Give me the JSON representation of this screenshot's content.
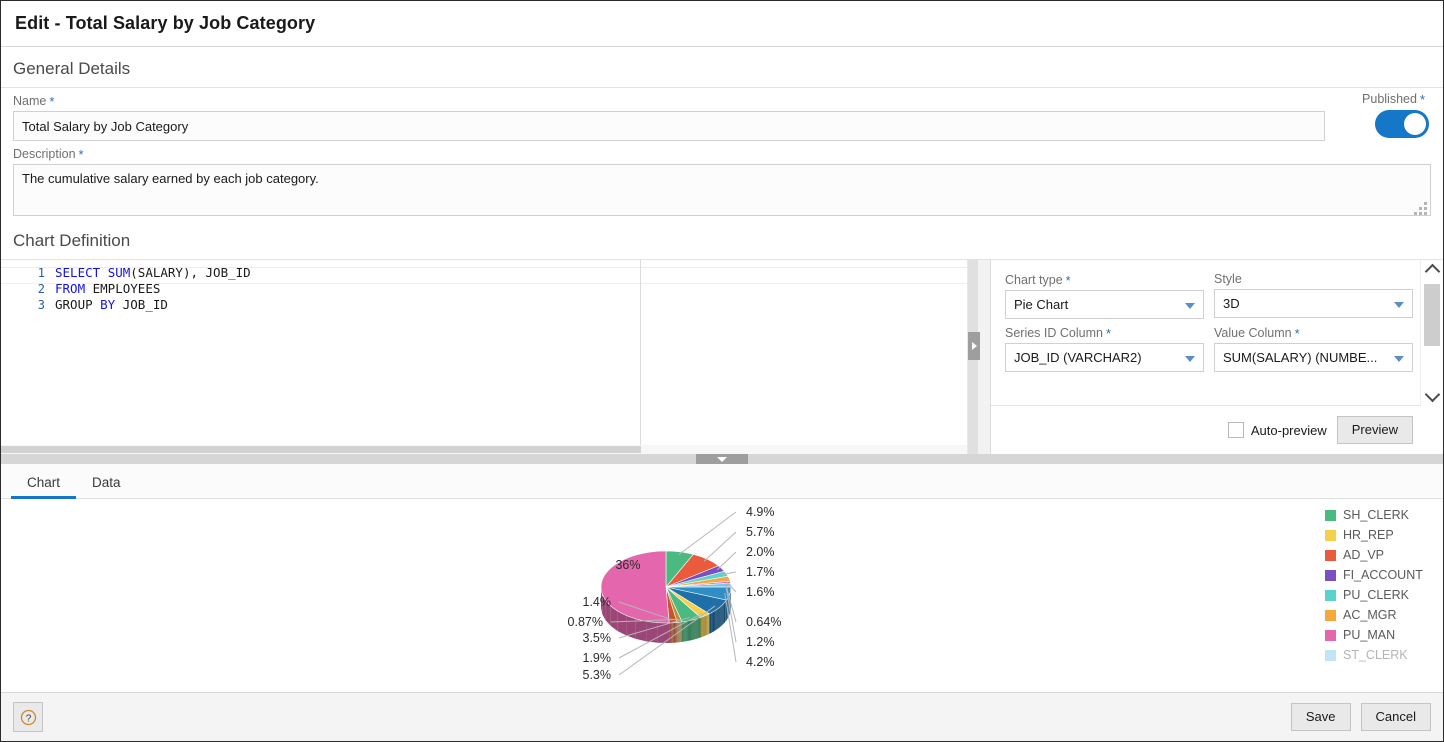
{
  "window": {
    "title": "Edit - Total Salary by Job Category"
  },
  "general": {
    "section_title": "General Details",
    "name_label": "Name",
    "name_value": "Total Salary by Job Category",
    "name_placeholder": "",
    "description_label": "Description",
    "description_value": "The cumulative salary earned by each job category.",
    "description_placeholder": "",
    "published_label": "Published",
    "published_state": "on",
    "required_marker": "*"
  },
  "chart_definition": {
    "section_title": "Chart Definition",
    "code_lines": [
      {
        "number": "1",
        "tokens": [
          {
            "t": "SELECT",
            "kw": true
          },
          {
            "t": " ",
            "kw": false
          },
          {
            "t": "SUM",
            "kw": true
          },
          {
            "t": "(SALARY), JOB_ID",
            "kw": false
          }
        ]
      },
      {
        "number": "2",
        "tokens": [
          {
            "t": "FROM",
            "kw": true
          },
          {
            "t": " EMPLOYEES",
            "kw": false
          }
        ]
      },
      {
        "number": "3",
        "tokens": [
          {
            "t": "GROUP ",
            "kw": false
          },
          {
            "t": "BY",
            "kw": true
          },
          {
            "t": " JOB_ID",
            "kw": false
          }
        ]
      }
    ]
  },
  "config": {
    "chart_type_label": "Chart type",
    "chart_type_value": "Pie Chart",
    "style_label": "Style",
    "style_value": "3D",
    "series_id_label": "Series ID Column",
    "series_id_value": "JOB_ID (VARCHAR2)",
    "value_column_label": "Value Column",
    "value_column_value": "SUM(SALARY) (NUMBE...",
    "auto_preview_label": "Auto-preview",
    "auto_preview_checked": "false",
    "preview_button": "Preview"
  },
  "tabs": [
    {
      "label": "Chart",
      "active": "true"
    },
    {
      "label": "Data",
      "active": "false"
    }
  ],
  "footer": {
    "help_icon": "question-mark-icon",
    "save_label": "Save",
    "cancel_label": "Cancel"
  },
  "chart_data": {
    "type": "pie",
    "title": "",
    "style": "3D",
    "legend_position": "right",
    "legend_entries": [
      {
        "label": "SH_CLERK",
        "color": "#4aba81"
      },
      {
        "label": "HR_REP",
        "color": "#f6d04d"
      },
      {
        "label": "AD_VP",
        "color": "#ea5a3c"
      },
      {
        "label": "FI_ACCOUNT",
        "color": "#7a4fc0"
      },
      {
        "label": "PU_CLERK",
        "color": "#5ad3cf"
      },
      {
        "label": "AC_MGR",
        "color": "#f6a83c"
      },
      {
        "label": "PU_MAN",
        "color": "#e467ae"
      },
      {
        "label": "ST_CLERK",
        "color": "#76c6ee"
      }
    ],
    "labels": [
      "SH_CLERK",
      "HR_REP",
      "AD_VP",
      "FI_ACCOUNT",
      "PU_CLERK",
      "AC_MGR",
      "PU_MAN",
      "ST_CLERK"
    ],
    "slices": [
      {
        "label": "4.9%",
        "value": 4.9,
        "color": "#4aba81"
      },
      {
        "label": "5.7%",
        "value": 5.7,
        "color": "#ea5a3c"
      },
      {
        "label": "2.0%",
        "value": 2.0,
        "color": "#7a4fc0"
      },
      {
        "label": "1.7%",
        "value": 1.7,
        "color": "#5ad3cf"
      },
      {
        "label": "1.6%",
        "value": 1.6,
        "color": "#f6a83c"
      },
      {
        "label": "0.64%",
        "value": 0.64,
        "color": "#e467ae"
      },
      {
        "label": "1.2%",
        "value": 1.2,
        "color": "#76c6ee"
      },
      {
        "label": "4.2%",
        "value": 4.2,
        "color": "#2f8fc4"
      },
      {
        "label": "5.3%",
        "value": 5.3,
        "color": "#1f6fa8"
      },
      {
        "label": "1.9%",
        "value": 1.9,
        "color": "#f6d04d"
      },
      {
        "label": "3.5%",
        "value": 3.5,
        "color": "#4aba81"
      },
      {
        "label": "0.87%",
        "value": 0.87,
        "color": "#b9933a"
      },
      {
        "label": "1.4%",
        "value": 1.4,
        "color": "#c9552e"
      },
      {
        "label": "36%",
        "value": 36.0,
        "color": "#e467ae"
      }
    ],
    "largest_slice": {
      "label": "36%",
      "value": 36.0,
      "color": "#e467ae"
    }
  }
}
